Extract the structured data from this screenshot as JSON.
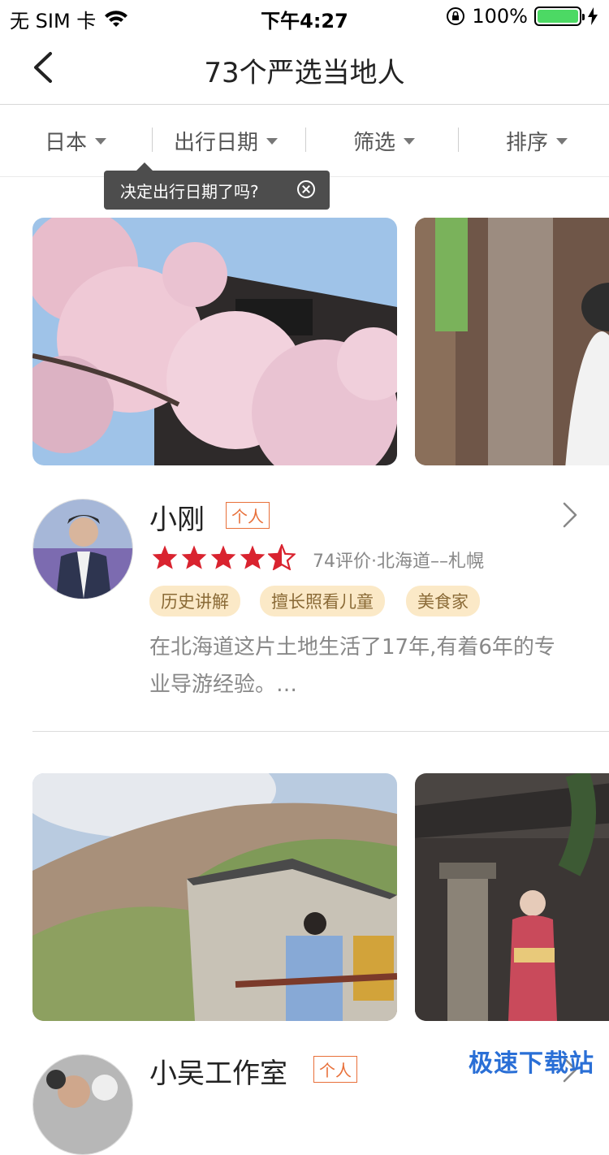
{
  "status_bar": {
    "carrier": "无 SIM 卡",
    "time": "下午4:27",
    "battery": "100%"
  },
  "nav": {
    "title": "73个严选当地人"
  },
  "filters": [
    {
      "label": "日本"
    },
    {
      "label": "出行日期"
    },
    {
      "label": "筛选"
    },
    {
      "label": "排序"
    }
  ],
  "tooltip": {
    "text": "决定出行日期了吗?"
  },
  "guides": [
    {
      "name": "小刚",
      "badge": "个人",
      "rating": 4.5,
      "meta": "74评价·北海道––札幌",
      "tags": [
        "历史讲解",
        "擅长照看儿童",
        "美食家"
      ],
      "description": "在北海道这片土地生活了17年,有着6年的专业导游经验。…"
    },
    {
      "name": "小吴工作室",
      "badge": "个人"
    }
  ],
  "watermark": "极速下载站",
  "colors": {
    "star": "#d9232f",
    "badge": "#e8703a",
    "chip_bg": "#fbe9c7",
    "chip_text": "#8a6a36",
    "battery": "#4cd964"
  }
}
